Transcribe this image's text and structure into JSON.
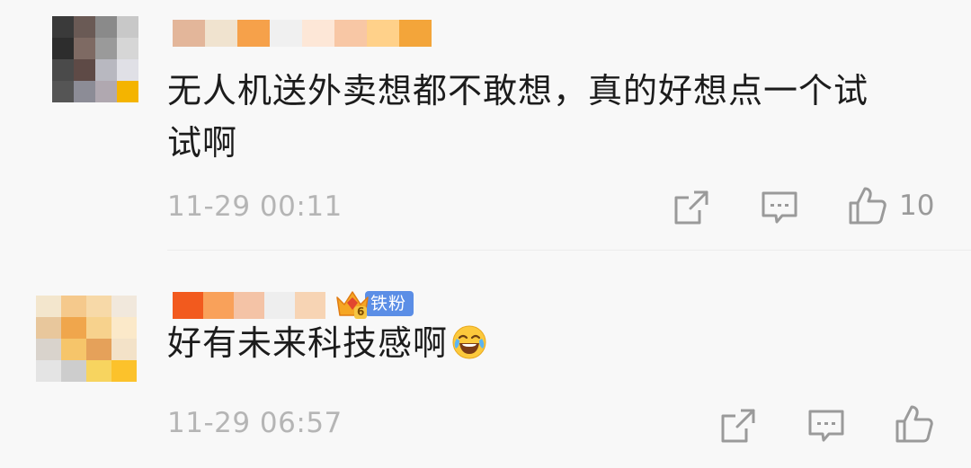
{
  "comments": [
    {
      "text_lines": [
        "无人机送外卖想都不敢想，真的好想点一个试",
        "试啊"
      ],
      "timestamp": "11-29 00:11",
      "like_count": "10",
      "avatar_colors": [
        "#3a3a3a",
        "#6a5a55",
        "#8a8a8a",
        "#c8c8c8",
        "#2d2d2d",
        "#7e6a63",
        "#9a9a9a",
        "#d6d6d6",
        "#4a4a4a",
        "#5e4a46",
        "#b8b8c0",
        "#e0e0e6",
        "#555555",
        "#8c8c96",
        "#b0a8b0",
        "#f4b400"
      ],
      "name_colors": [
        "#e3b69a",
        "#f0e3cf",
        "#f6a14a",
        "#f0f0f0",
        "#fde7d7",
        "#f8c7a5",
        "#ffd18a",
        "#f3a53a"
      ]
    },
    {
      "text": "好有未来科技感啊",
      "emoji": "laughing-with-tears-emoji",
      "timestamp": "11-29 06:57",
      "badge_label": "铁粉",
      "badge_level": "6",
      "avatar_colors": [
        "#f3e6cd",
        "#f5c98c",
        "#f7d9a8",
        "#f1e8dc",
        "#e8c79c",
        "#f0a64c",
        "#f7d28d",
        "#fbe9c9",
        "#d9d3cc",
        "#f6c56a",
        "#e5a15a",
        "#f3e2c8",
        "#e4e4e4",
        "#cdcdcd",
        "#f7d45f",
        "#fcc22b"
      ],
      "name_colors": [
        "#f25a1e",
        "#f9a15a",
        "#f4c3a6",
        "#eeeeee",
        "#f7d4b4"
      ]
    }
  ],
  "colors": {
    "background": "#f8f8f8",
    "text": "#1c1c1c",
    "timestamp": "#b5b5b5",
    "icon": "#9a9a9a",
    "badge": "#5b8ee6"
  }
}
